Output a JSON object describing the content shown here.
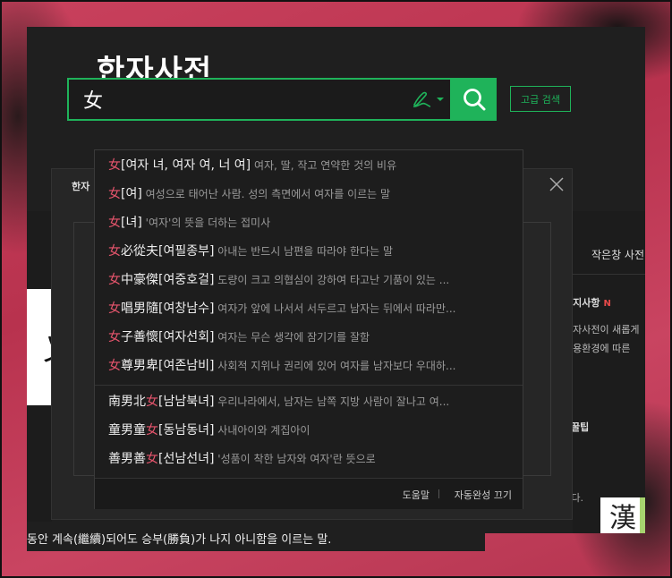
{
  "page": {
    "title": "한자사전"
  },
  "search": {
    "value": "女",
    "advanced_label": "고급 검색"
  },
  "under": {
    "tab_label": "한자",
    "right_link": "작은창 사전",
    "right_heading": "공지사항",
    "right_new": "N",
    "right_line1": "한자사전이 새롭게",
    "right_line2": "사용환경에 따른",
    "right_tip": "꿀팁",
    "right_notice": "있습니다.",
    "han_badge": "漢",
    "white_card_char": "乂",
    "bottom_text": "동안 계속(繼續)되어도 승부(勝負)가 나지 아니함을 이르는 말."
  },
  "autocomplete": {
    "items": [
      {
        "pre": "",
        "hl": "女",
        "post": "",
        "reading": "[여자 녀, 여자 여, 너 여]",
        "desc": "여자, 딸, 작고 연약한 것의 비유"
      },
      {
        "pre": "",
        "hl": "女",
        "post": "",
        "reading": "[여]",
        "desc": "여성으로 태어난 사람. 성의 측면에서 여자를 이르는 말"
      },
      {
        "pre": "",
        "hl": "女",
        "post": "",
        "reading": "[녀]",
        "desc": "'여자'의 뜻을 더하는 접미사"
      },
      {
        "pre": "",
        "hl": "女",
        "post": "必從夫",
        "reading": "[여필종부]",
        "desc": "아내는 반드시 남편을 따라야 한다는 말"
      },
      {
        "pre": "",
        "hl": "女",
        "post": "中豪傑",
        "reading": "[여중호걸]",
        "desc": "도량이 크고 의협심이 강하여 타고난 기품이 있는 ..."
      },
      {
        "pre": "",
        "hl": "女",
        "post": "唱男隨",
        "reading": "[여창남수]",
        "desc": "여자가 앞에 나서서 서두르고 남자는 뒤에서 따라만..."
      },
      {
        "pre": "",
        "hl": "女",
        "post": "子善懷",
        "reading": "[여자선회]",
        "desc": "여자는 무슨 생각에 잠기기를 잘함"
      },
      {
        "pre": "",
        "hl": "女",
        "post": "尊男卑",
        "reading": "[여존남비]",
        "desc": "사회적 지위나 권리에 있어 여자를 남자보다 우대하..."
      },
      {
        "pre": "南男北",
        "hl": "女",
        "post": "",
        "reading": "[남남북녀]",
        "desc": "우리나라에서, 남자는 남쪽 지방 사람이 잘나고 여..."
      },
      {
        "pre": "童男童",
        "hl": "女",
        "post": "",
        "reading": "[동남동녀]",
        "desc": "사내아이와 계집아이"
      },
      {
        "pre": "善男善",
        "hl": "女",
        "post": "",
        "reading": "[선남선녀]",
        "desc": "'성품이 착한 남자와 여자'란 뜻으로"
      }
    ],
    "help_label": "도움말",
    "autocomplete_off_label": "자동완성 끄기"
  },
  "colors": {
    "accent": "#1fb35a",
    "highlight": "#e8556d",
    "background": "#1f1f1f"
  }
}
